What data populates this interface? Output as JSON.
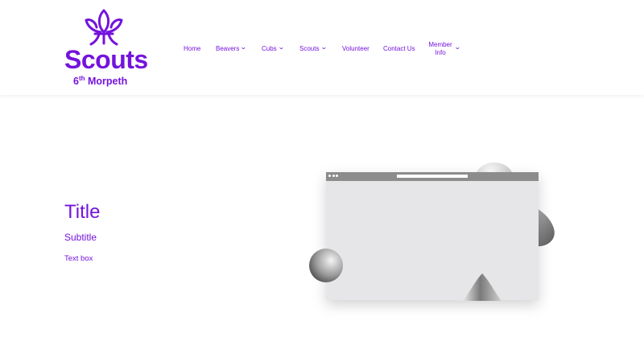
{
  "brand": {
    "name": "Scouts",
    "group_number": "6",
    "group_suffix": "th",
    "group_name": "Morpeth",
    "color": "#7413dc"
  },
  "nav": {
    "items": [
      {
        "label": "Home",
        "has_dropdown": false
      },
      {
        "label": "Beavers",
        "has_dropdown": true
      },
      {
        "label": "Cubs",
        "has_dropdown": true
      },
      {
        "label": "Scouts",
        "has_dropdown": true
      },
      {
        "label": "Volunteer",
        "has_dropdown": false
      },
      {
        "label": "Contact Us",
        "has_dropdown": false
      }
    ],
    "member": {
      "line1": "Member",
      "line2": "Info",
      "has_dropdown": true
    },
    "dropdown_icon": "chevron-down-icon"
  },
  "hero": {
    "title": "Title",
    "subtitle": "Subtitle",
    "text": "Text box",
    "illustration_icon": "browser-window-illustration"
  }
}
